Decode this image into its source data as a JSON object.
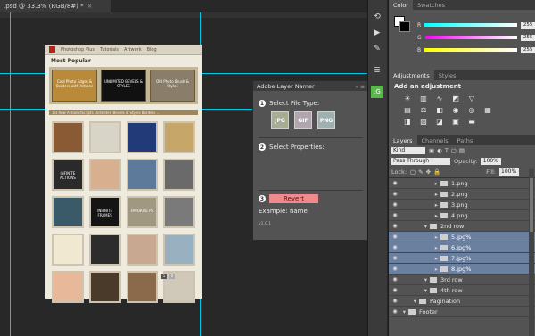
{
  "document": {
    "tab_title": ".psd @ 33.3% (RGB/8#) *",
    "tab_close": "×"
  },
  "site": {
    "logo_text": "Photoshop Plus",
    "nav": [
      "Photoshop Plus",
      "Tutorials",
      "Artwork",
      "Blog"
    ],
    "section_title": "Most Popular",
    "banner": [
      "Cool Photo Edges & Borders with Actions",
      "UNLIMITED BEVELS & STYLES",
      "Old Photo Brush & Styles"
    ],
    "bar_text": "1st Row  Actions/Scripts  Unlimited Bevels & Styles  Borders  ...",
    "tiles": [
      "",
      "",
      "",
      "",
      "INFINITE ACTIONS",
      "",
      "",
      "",
      "",
      "INFINITE FRAMES",
      "FAVORITE PS",
      "",
      "",
      "",
      "",
      "",
      "",
      "",
      "",
      ""
    ],
    "pager": [
      "1",
      "2"
    ]
  },
  "namer": {
    "title": "Adobe Layer Namer",
    "collapse": "»",
    "menu": "≡",
    "step1_num": "1",
    "step1_label": "Select File Type:",
    "types": [
      "JPG",
      "GIF",
      "PNG"
    ],
    "step2_num": "2",
    "step2_label": "Select Properties:",
    "step3_num": "3",
    "revert": "Revert",
    "example_label": "Example:",
    "example_value": "name",
    "version": "v1.0.1"
  },
  "color_panel": {
    "tabs": [
      "Color",
      "Swatches"
    ],
    "channels": [
      {
        "label": "R",
        "value": "255"
      },
      {
        "label": "G",
        "value": "255"
      },
      {
        "label": "B",
        "value": "255"
      }
    ]
  },
  "adjustments": {
    "tabs": [
      "Adjustments",
      "Styles"
    ],
    "heading": "Add an adjustment"
  },
  "layers": {
    "tabs": [
      "Layers",
      "Channels",
      "Paths"
    ],
    "kind": "Kind",
    "blend": "Pass Through",
    "opacity_label": "Opacity:",
    "opacity": "100%",
    "lock_label": "Lock:",
    "fill_label": "Fill:",
    "fill": "100%",
    "rows": [
      {
        "name": "1.png",
        "indent": 3,
        "folder": false,
        "sel": false
      },
      {
        "name": "2.png",
        "indent": 3,
        "folder": false,
        "sel": false
      },
      {
        "name": "3.png",
        "indent": 3,
        "folder": false,
        "sel": false
      },
      {
        "name": "4.png",
        "indent": 3,
        "folder": false,
        "sel": false
      },
      {
        "name": "2nd row",
        "indent": 2,
        "folder": true,
        "sel": false
      },
      {
        "name": "5.jpg%",
        "indent": 3,
        "folder": false,
        "sel": true
      },
      {
        "name": "6.jpg%",
        "indent": 3,
        "folder": false,
        "sel": true
      },
      {
        "name": "7.jpg%",
        "indent": 3,
        "folder": false,
        "sel": true
      },
      {
        "name": "8.jpg%",
        "indent": 3,
        "folder": false,
        "sel": true
      },
      {
        "name": "3rd row",
        "indent": 2,
        "folder": true,
        "sel": false
      },
      {
        "name": "4th row",
        "indent": 2,
        "folder": true,
        "sel": false
      },
      {
        "name": "Pagination",
        "indent": 1,
        "folder": true,
        "sel": false
      },
      {
        "name": "Footer",
        "indent": 0,
        "folder": true,
        "sel": false
      }
    ]
  },
  "colors": {
    "accent": "#6b7f9e",
    "guide": "#00c8e6",
    "revert": "#f08a8e"
  }
}
